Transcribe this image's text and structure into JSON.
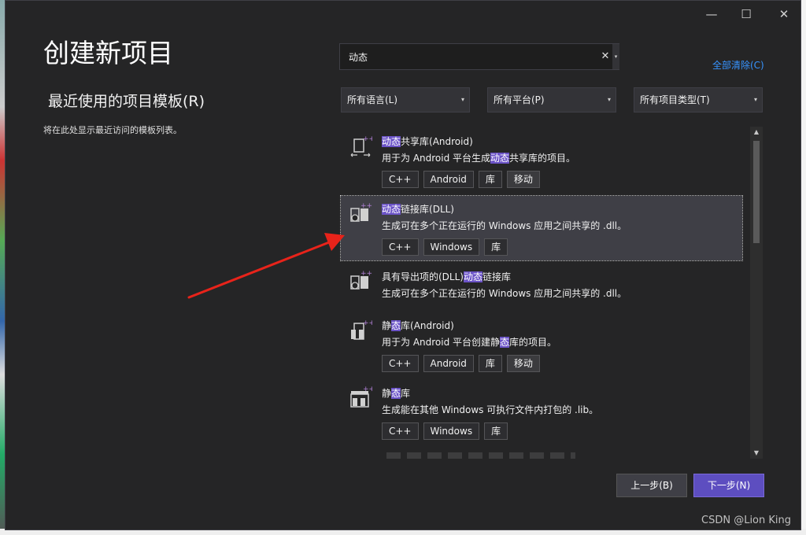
{
  "window": {
    "minimize_glyph": "—",
    "maximize_glyph": "☐",
    "close_glyph": "✕"
  },
  "page_title": "创建新项目",
  "recent": {
    "title": "最近使用的项目模板(R)",
    "empty_text": "将在此处显示最近访问的模板列表。"
  },
  "search": {
    "value": "动态",
    "clear_glyph": "✕",
    "dropdown_glyph": "▾"
  },
  "clear_all_label": "全部清除(C)",
  "filters": {
    "language": "所有语言(L)",
    "platform": "所有平台(P)",
    "project_type": "所有项目类型(T)",
    "arrow_glyph": "▾"
  },
  "templates": [
    {
      "name_hl": "动态",
      "name_rest": "共享库(Android)",
      "desc_pre": "用于为 Android 平台生成",
      "desc_hl": "动态",
      "desc_post": "共享库的项目。",
      "tags": [
        "C++",
        "Android",
        "库",
        "移动"
      ],
      "icon": "shared-library-icon"
    },
    {
      "name_hl": "动态",
      "name_rest": "链接库(DLL)",
      "desc": "生成可在多个正在运行的 Windows 应用之间共享的 .dll。",
      "tags": [
        "C++",
        "Windows",
        "库"
      ],
      "icon": "dll-icon",
      "selected": true
    },
    {
      "name_pre": "具有导出项的(DLL)",
      "name_hl": "动态",
      "name_post": "链接库",
      "desc": "生成可在多个正在运行的 Windows 应用之间共享的 .dll。",
      "icon": "dll-export-icon"
    },
    {
      "name_pre": "静",
      "name_hl": "态",
      "name_post": "库(Android)",
      "desc_pre": "用于为 Android 平台创建静",
      "desc_hl": "态",
      "desc_post": "库的项目。",
      "tags": [
        "C++",
        "Android",
        "库",
        "移动"
      ],
      "icon": "static-library-icon"
    },
    {
      "name_pre": "静",
      "name_hl": "态",
      "name_post": "库",
      "desc": "生成能在其他 Windows 可执行文件内打包的 .lib。",
      "tags": [
        "C++",
        "Windows",
        "库"
      ],
      "icon": "static-lib-windows-icon"
    }
  ],
  "scrollbar": {
    "up_glyph": "▲",
    "down_glyph": "▼"
  },
  "buttons": {
    "back": "上一步(B)",
    "next": "下一步(N)"
  },
  "watermark": "CSDN @Lion King",
  "colors": {
    "dialog_bg": "#252526",
    "highlight": "#6b53c7",
    "next_button": "#5d4ec0",
    "link": "#3794ff",
    "arrow": "#e8231a"
  }
}
